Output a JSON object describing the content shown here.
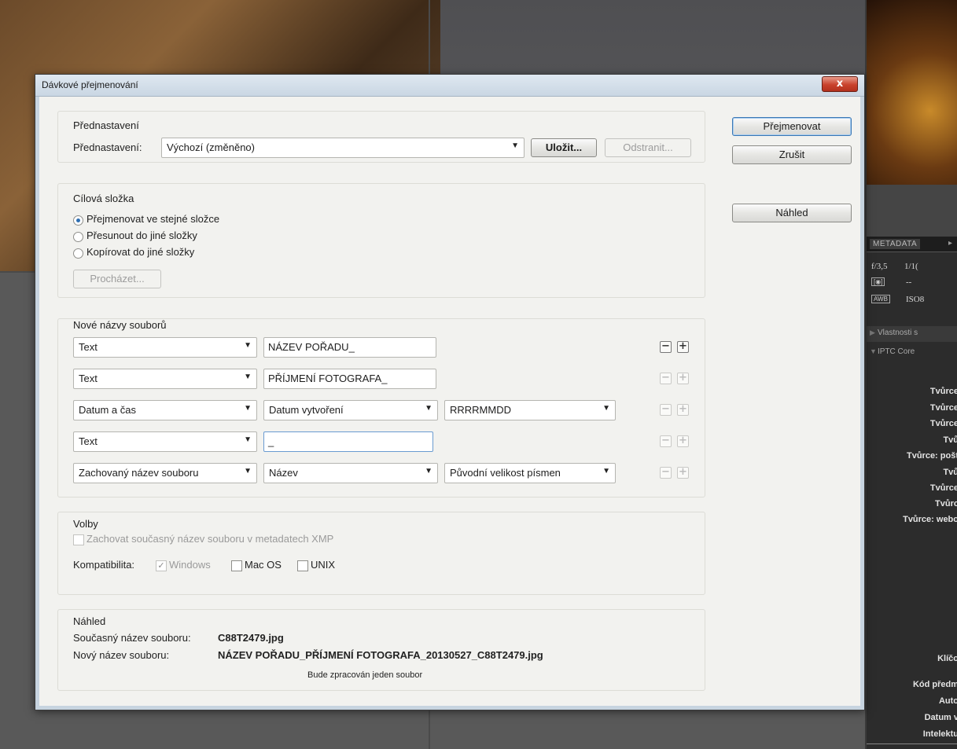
{
  "dialog": {
    "title": "Dávkové přejmenování",
    "close_glyph": "x"
  },
  "buttons": {
    "rename": "Přejmenovat",
    "cancel": "Zrušit",
    "preview": "Náhled"
  },
  "presets": {
    "group_title": "Přednastavení",
    "label": "Přednastavení:",
    "selected": "Výchozí (změněno)",
    "save_button": "Uložit...",
    "delete_button": "Odstranit..."
  },
  "destination": {
    "group_title": "Cílová složka",
    "options": [
      {
        "label": "Přejmenovat ve stejné složce",
        "selected": true
      },
      {
        "label": "Přesunout do jiné složky",
        "selected": false
      },
      {
        "label": "Kopírovat do jiné složky",
        "selected": false
      }
    ],
    "browse_button": "Procházet..."
  },
  "new_names": {
    "group_title": "Nové názvy souborů",
    "rows": [
      {
        "type": "Text",
        "value": "NÁZEV POŘADU_"
      },
      {
        "type": "Text",
        "value": "PŘÍJMENÍ FOTOGRAFA_"
      },
      {
        "type": "Datum a čas",
        "option1": "Datum vytvoření",
        "option2": "RRRRMMDD"
      },
      {
        "type": "Text",
        "value": "_"
      },
      {
        "type": "Zachovaný název souboru",
        "option1": "Název",
        "option2": "Původní velikost písmen"
      }
    ],
    "minus_glyph": "−",
    "plus_glyph": "+"
  },
  "options": {
    "group_title": "Volby",
    "preserve_xmp_label": "Zachovat současný název souboru v metadatech XMP",
    "compatibility_label": "Kompatibilita:",
    "windows_label": "Windows",
    "windows_checked": true,
    "macos_label": "Mac OS",
    "macos_checked": false,
    "unix_label": "UNIX",
    "unix_checked": false
  },
  "preview": {
    "group_title": "Náhled",
    "current_label": "Současný název souboru:",
    "current_value": "C88T2479.jpg",
    "new_label": "Nový název souboru:",
    "new_value": "NÁZEV POŘADU_PŘÍJMENÍ FOTOGRAFA_20130527_C88T2479.jpg",
    "info": "Bude zpracován jeden soubor"
  },
  "right_panel": {
    "tab_metadata": "METADATA",
    "tab_more": "▸",
    "aperture": "f/3,5",
    "shutter": "1/1(",
    "metering_icon": "[◉]",
    "dash": "--",
    "awb": "AWB",
    "iso": "ISO8",
    "section_props": "Vlastnosti s",
    "section_iptc": "IPTC Core",
    "fields": [
      "Tvůrce",
      "Tvůrce",
      "Tvůrce",
      "Tvů",
      "Tvůrce: pošt",
      "Tvů",
      "Tvůrce",
      "Tvůrc",
      "Tvůrce: webo",
      "Klíčo",
      "Kód předm",
      "Auto",
      "Datum v",
      "Intelektu"
    ]
  }
}
